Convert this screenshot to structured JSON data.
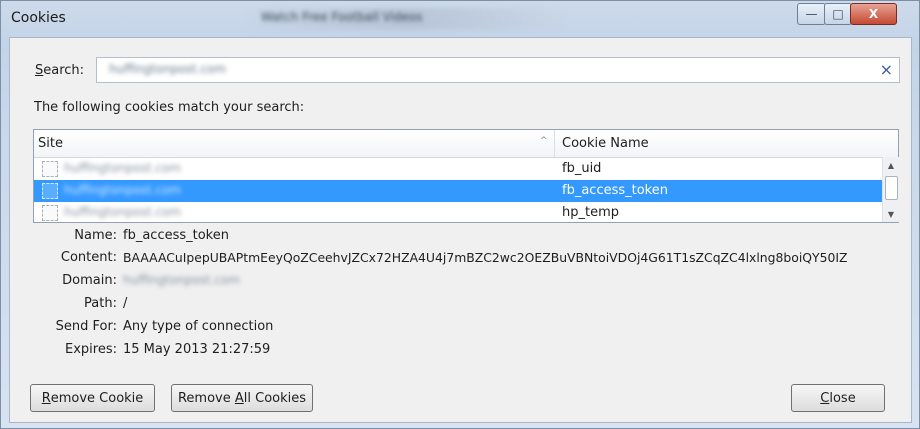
{
  "window": {
    "title": "Cookies",
    "background_title": "Watch Free Football Videos",
    "controls": {
      "minimize": "—",
      "maximize": "□",
      "close": "X"
    }
  },
  "search": {
    "label_prefix": "S",
    "label_rest": "earch:",
    "value": "huffingtonpost.com",
    "clear_symbol": "×"
  },
  "match_text": "The following cookies match your search:",
  "table": {
    "columns": {
      "site": "Site",
      "cookie_name": "Cookie Name",
      "sort_glyph": "^"
    },
    "rows": [
      {
        "site": "huffingtonpost.com",
        "name": "fb_uid",
        "selected": false
      },
      {
        "site": "huffingtonpost.com",
        "name": "fb_access_token",
        "selected": true
      },
      {
        "site": "huffingtonpost.com",
        "name": "hp_temp",
        "selected": false
      }
    ],
    "scroll": {
      "up": "▲",
      "down": "▼"
    }
  },
  "details": {
    "name_label": "Name:",
    "name_value": "fb_access_token",
    "content_label": "Content:",
    "content_value": "BAAAACuIpepUBAPtmEeyQoZCeehvJZCx72HZA4U4j7mBZC2wc2OEZBuVBNtoiVDOj4G61T1sZCqZC4lxlng8boiQY50IZ",
    "domain_label": "Domain:",
    "domain_value": "huffingtonpost.com",
    "path_label": "Path:",
    "path_value": "/",
    "sendfor_label": "Send For:",
    "sendfor_value": "Any type of connection",
    "expires_label": "Expires:",
    "expires_value": "15 May 2013 21:27:59"
  },
  "buttons": {
    "remove_prefix": "R",
    "remove_rest": "emove Cookie",
    "remove_all_pre": "Remove ",
    "remove_all_u": "A",
    "remove_all_rest": "ll Cookies",
    "close_prefix": "C",
    "close_rest": "lose"
  }
}
